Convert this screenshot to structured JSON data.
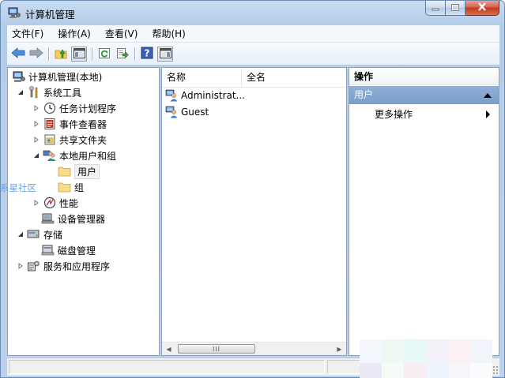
{
  "window": {
    "title": "计算机管理",
    "caption_buttons": [
      "minimize",
      "maximize",
      "close"
    ]
  },
  "menubar": {
    "items": [
      "文件(F)",
      "操作(A)",
      "查看(V)",
      "帮助(H)"
    ]
  },
  "toolbar": {
    "buttons": [
      "back-icon",
      "forward-icon",
      "up-folder-icon",
      "show-hide-tree-icon",
      "refresh-icon",
      "export-list-icon",
      "help-icon",
      "show-hide-action-pane-icon"
    ]
  },
  "tree": {
    "root": "计算机管理(本地)",
    "system_tools": "系统工具",
    "task_scheduler": "任务计划程序",
    "event_viewer": "事件查看器",
    "shared_folders": "共享文件夹",
    "local_users_groups": "本地用户和组",
    "users": "用户",
    "groups": "组",
    "performance": "性能",
    "device_manager": "设备管理器",
    "storage": "存储",
    "disk_management": "磁盘管理",
    "services_apps": "服务和应用程序"
  },
  "list": {
    "columns": [
      "名称",
      "全名"
    ],
    "rows": [
      {
        "name": "Administrat...",
        "fullname": ""
      },
      {
        "name": "Guest",
        "fullname": ""
      }
    ],
    "scroll_thumb_label": "III"
  },
  "actions": {
    "title": "操作",
    "section": "用户",
    "more": "更多操作"
  },
  "watermark": "系星社区",
  "colors": {
    "section_header": "#7a9ec9",
    "selection": "#f3f3f3",
    "frame": "#b4cde8"
  }
}
